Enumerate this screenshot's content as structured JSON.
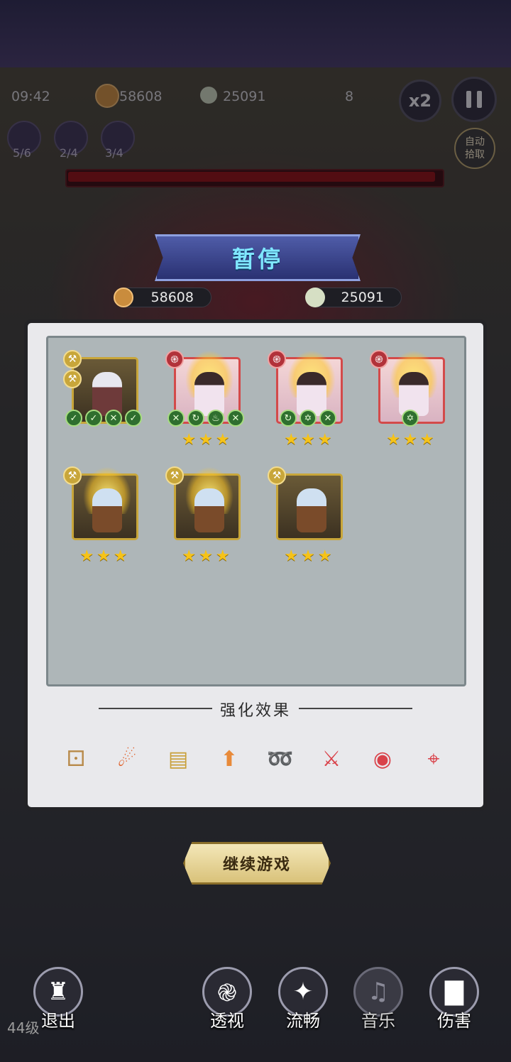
{
  "hud": {
    "timer": "09:42",
    "coins": "58608",
    "skulls": "25091",
    "kills": "8",
    "speed": "x2",
    "skills": [
      {
        "icon": "dragon-icon",
        "count": "5/6"
      },
      {
        "icon": "sword-icon",
        "count": "2/4"
      },
      {
        "icon": "swirl-icon",
        "count": "3/4"
      }
    ],
    "auto_pick": "自动拾取",
    "boss_hp_fraction": 0.99
  },
  "pause_panel": {
    "title": "暂停",
    "coins": "58608",
    "skulls": "25091",
    "effects_title": "强化效果",
    "continue_label": "继续游戏"
  },
  "heroes": [
    {
      "frame": "gold",
      "classes": [
        "wrench-icon",
        "wrench-icon"
      ],
      "traits": [
        "green",
        "green",
        "cross",
        "green"
      ],
      "stars": 0,
      "glow": false,
      "sprite": "white"
    },
    {
      "frame": "red",
      "classes": [
        "spiral-icon"
      ],
      "traits": [
        "cross",
        "swirl",
        "flame",
        "cross"
      ],
      "stars": 3,
      "glow": true,
      "sprite": "dark"
    },
    {
      "frame": "red",
      "classes": [
        "spiral-icon"
      ],
      "traits": [
        "swirl",
        "star",
        "cross"
      ],
      "stars": 3,
      "glow": true,
      "sprite": "dark"
    },
    {
      "frame": "red",
      "classes": [
        "spiral-icon"
      ],
      "traits": [
        "star"
      ],
      "stars": 3,
      "glow": true,
      "sprite": "dark"
    },
    {
      "frame": "gold",
      "classes": [
        "wrench-icon"
      ],
      "traits": [],
      "stars": 3,
      "glow": true,
      "sprite": "silver"
    },
    {
      "frame": "gold",
      "classes": [
        "wrench-icon"
      ],
      "traits": [],
      "stars": 3,
      "glow": true,
      "sprite": "silver"
    },
    {
      "frame": "gold",
      "classes": [
        "wrench-icon"
      ],
      "traits": [],
      "stars": 3,
      "glow": false,
      "sprite": "silver"
    }
  ],
  "effects": [
    "voodoo-doll-icon",
    "flame-spear-icon",
    "spell-book-icon",
    "power-up-icon",
    "dash-icon",
    "sword-icon",
    "vortex-icon",
    "target-icon"
  ],
  "bottom_bar": [
    {
      "label": "退出",
      "icon": "castle-icon",
      "muted": false
    },
    {
      "label": "透视",
      "icon": "spiral-icon",
      "muted": false
    },
    {
      "label": "流畅",
      "icon": "sparkle-icon",
      "muted": false
    },
    {
      "label": "音乐",
      "icon": "speaker-icon",
      "muted": true
    },
    {
      "label": "伤害",
      "icon": "bar-chart-icon",
      "muted": false
    }
  ],
  "level": "44级"
}
